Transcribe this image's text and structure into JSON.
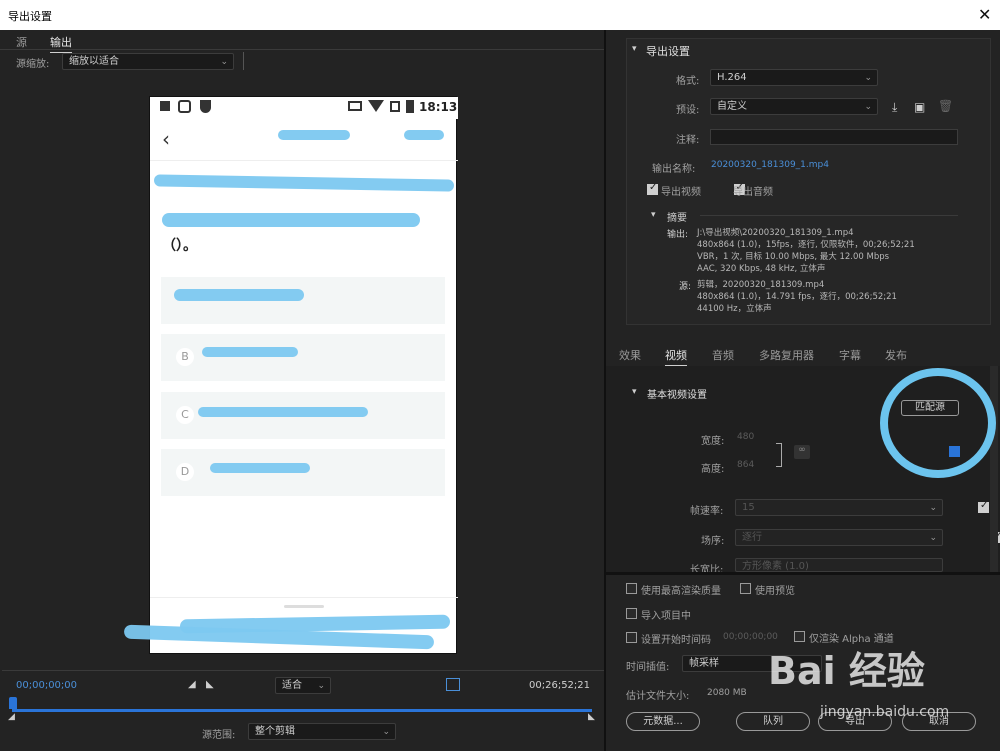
{
  "window": {
    "title": "导出设置",
    "close": "✕"
  },
  "left": {
    "tabs": [
      "源",
      "输出"
    ],
    "source_scale_label": "源缩放:",
    "source_scale_value": "缩放以适合",
    "phone": {
      "time": "18:13",
      "options": [
        "B",
        "C",
        "D"
      ],
      "question_end": "（）。"
    },
    "timecode_start": "00;00;00;00",
    "timecode_end": "00;26;52;21",
    "fit_value": "适合",
    "source_range_label": "源范围:",
    "source_range_value": "整个剪辑"
  },
  "export": {
    "section_title": "导出设置",
    "format_label": "格式:",
    "format_value": "H.264",
    "preset_label": "预设:",
    "preset_value": "自定义",
    "comment_label": "注释:",
    "output_name_label": "输出名称:",
    "output_name_value": "20200320_181309_1.mp4",
    "export_video": "导出视频",
    "export_audio": "导出音频",
    "summary_title": "摘要",
    "output_key": "输出:",
    "output_lines": [
      "J:\\导出视频\\20200320_181309_1.mp4",
      "480x864 (1.0)，15fps，逐行, 仅限软件，00;26;52;21",
      "VBR，1 次, 目标 10.00 Mbps, 最大 12.00 Mbps",
      "AAC, 320 Kbps, 48  kHz, 立体声"
    ],
    "source_key": "源:",
    "source_lines": [
      "剪辑，20200320_181309.mp4",
      "480x864 (1.0)，14.791 fps，逐行，00;26;52;21",
      "44100 Hz，立体声"
    ]
  },
  "tabs2": [
    "效果",
    "视频",
    "音频",
    "多路复用器",
    "字幕",
    "发布"
  ],
  "video": {
    "section_title": "基本视频设置",
    "match_source": "匹配源",
    "width_label": "宽度:",
    "width_value": "480",
    "height_label": "高度:",
    "height_value": "864",
    "fps_label": "帧速率:",
    "fps_value": "15",
    "field_label": "场序:",
    "field_value": "逐行",
    "aspect_label": "长宽比:",
    "aspect_value": "方形像素 (1.0)"
  },
  "bottom": {
    "max_quality": "使用最高渲染质量",
    "use_preview": "使用预览",
    "import_project": "导入项目中",
    "set_start_tc": "设置开始时间码",
    "start_tc_value": "00;00;00;00",
    "render_alpha": "仅渲染 Alpha 通道",
    "interp_label": "时间插值:",
    "interp_value": "帧采样",
    "est_size_label": "估计文件大小:",
    "est_size_value": "2080 MB",
    "metadata_btn": "元数据...",
    "queue_btn": "队列",
    "export_btn": "导出",
    "cancel_btn": "取消"
  },
  "watermark": {
    "text": "Bai 经验",
    "sub": "jingyan.baidu.com"
  }
}
